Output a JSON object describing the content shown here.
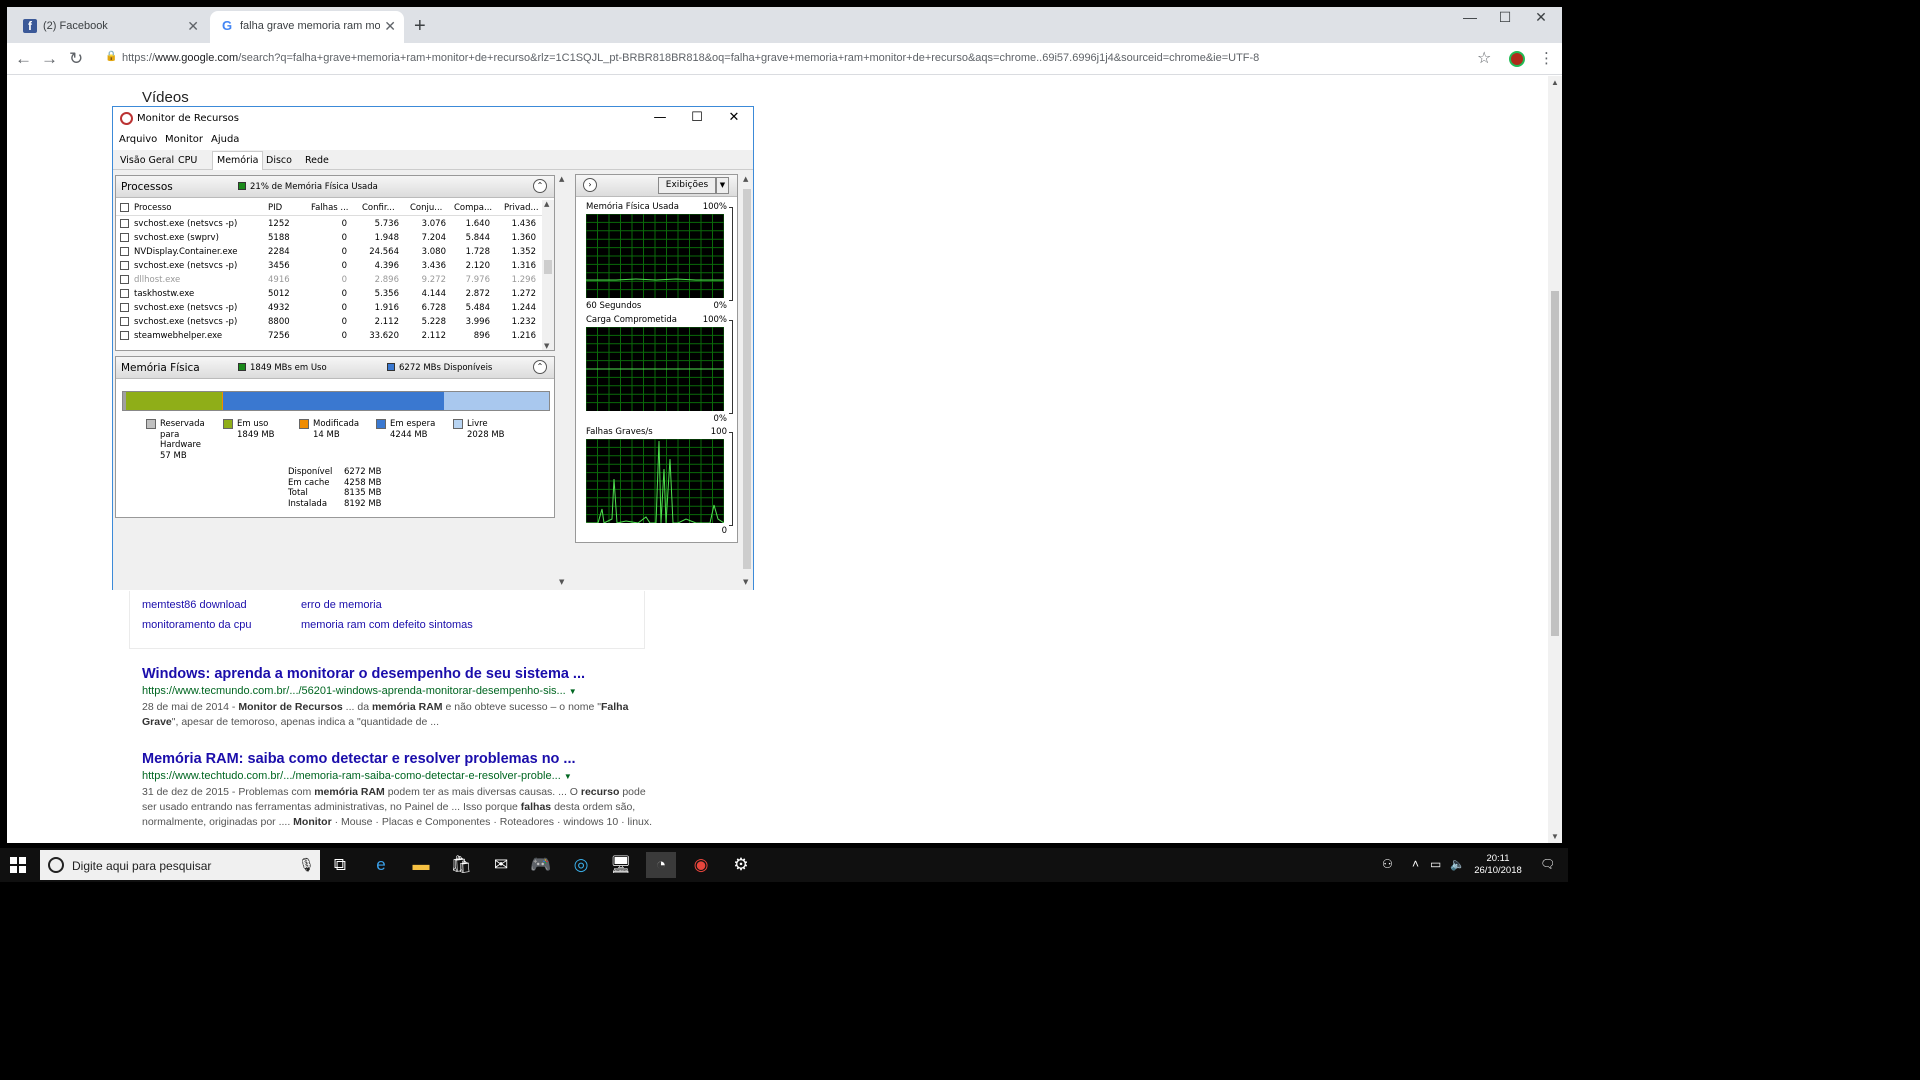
{
  "browser": {
    "tabs": [
      {
        "title": "(2) Facebook",
        "icon": "facebook-icon"
      },
      {
        "title": "falha grave memoria ram monito",
        "icon": "google-icon"
      }
    ],
    "url_prefix": "https://",
    "url_domain": "www.google.com",
    "url_rest": "/search?q=falha+grave+memoria+ram+monitor+de+recurso&rlz=1C1SQJL_pt-BRBR818BR818&oq=falha+grave+memoria+ram+monitor+de+recurso&aqs=chrome..69i57.6996j1j4&sourceid=chrome&ie=UTF-8"
  },
  "search_page": {
    "section_heading": "Vídeos",
    "related": [
      "memtest86 download",
      "erro de memoria",
      "monitoramento da cpu",
      "memoria ram com defeito sintomas"
    ],
    "results": [
      {
        "title": "Windows: aprenda a monitorar o desempenho de seu sistema ...",
        "url": "https://www.tecmundo.com.br/.../56201-windows-aprenda-monitorar-desempenho-sis...",
        "snippet_html": "28 de mai de 2014 - <b>Monitor de Recursos</b> ... da <b>memória RAM</b> e não obteve sucesso – o nome \"<b>Falha Grave</b>\", apesar de temoroso, apenas indica a \"quantidade de ..."
      },
      {
        "title": "Memória RAM: saiba como detectar e resolver problemas no ...",
        "url": "https://www.techtudo.com.br/.../memoria-ram-saiba-como-detectar-e-resolver-proble...",
        "snippet_html": "31 de dez de 2015 - Problemas com <b>memória RAM</b> podem ter as mais diversas causas. ... O <b>recurso</b> pode ser usado entrando nas ferramentas administrativas, no Painel de ... Isso porque <b>falhas</b> desta ordem são, normalmente, originadas por .... <b>Monitor</b> · Mouse · Placas e Componentes · Roteadores · windows 10 · linux."
      }
    ]
  },
  "resmon": {
    "title": "Monitor de Recursos",
    "menu": [
      "Arquivo",
      "Monitor",
      "Ajuda"
    ],
    "tabs": [
      "Visão Geral",
      "CPU",
      "Memória",
      "Disco",
      "Rede"
    ],
    "active_tab": "Memória",
    "processes": {
      "title": "Processos",
      "indicator": "21% de Memória Física Usada",
      "indicator_color": "#1a8a1a",
      "columns": [
        "Processo",
        "PID",
        "Falhas ...",
        "Confir...",
        "Conju...",
        "Compa...",
        "Privad..."
      ],
      "rows": [
        {
          "name": "svchost.exe (netsvcs -p)",
          "pid": "1252",
          "faults": "0",
          "commit": "5.736",
          "ws": "3.076",
          "share": "1.640",
          "priv": "1.436",
          "dim": false
        },
        {
          "name": "svchost.exe (swprv)",
          "pid": "5188",
          "faults": "0",
          "commit": "1.948",
          "ws": "7.204",
          "share": "5.844",
          "priv": "1.360",
          "dim": false
        },
        {
          "name": "NVDisplay.Container.exe",
          "pid": "2284",
          "faults": "0",
          "commit": "24.564",
          "ws": "3.080",
          "share": "1.728",
          "priv": "1.352",
          "dim": false
        },
        {
          "name": "svchost.exe (netsvcs -p)",
          "pid": "3456",
          "faults": "0",
          "commit": "4.396",
          "ws": "3.436",
          "share": "2.120",
          "priv": "1.316",
          "dim": false
        },
        {
          "name": "dllhost.exe",
          "pid": "4916",
          "faults": "0",
          "commit": "2.896",
          "ws": "9.272",
          "share": "7.976",
          "priv": "1.296",
          "dim": true
        },
        {
          "name": "taskhostw.exe",
          "pid": "5012",
          "faults": "0",
          "commit": "5.356",
          "ws": "4.144",
          "share": "2.872",
          "priv": "1.272",
          "dim": false
        },
        {
          "name": "svchost.exe (netsvcs -p)",
          "pid": "4932",
          "faults": "0",
          "commit": "1.916",
          "ws": "6.728",
          "share": "5.484",
          "priv": "1.244",
          "dim": false
        },
        {
          "name": "svchost.exe (netsvcs -p)",
          "pid": "8800",
          "faults": "0",
          "commit": "2.112",
          "ws": "5.228",
          "share": "3.996",
          "priv": "1.232",
          "dim": false
        },
        {
          "name": "steamwebhelper.exe",
          "pid": "7256",
          "faults": "0",
          "commit": "33.620",
          "ws": "2.112",
          "share": "896",
          "priv": "1.216",
          "dim": false
        }
      ]
    },
    "physical": {
      "title": "Memória Física",
      "in_use_indicator": "1849 MBs em Uso",
      "available_indicator": "6272 MBs Disponíveis",
      "bar": [
        {
          "key": "reserved",
          "mb": 57,
          "color": "#a0a0a0"
        },
        {
          "key": "inuse",
          "mb": 1849,
          "color": "#8fae18"
        },
        {
          "key": "modified",
          "mb": 14,
          "color": "#f08c00"
        },
        {
          "key": "standby",
          "mb": 4244,
          "color": "#3a78d0"
        },
        {
          "key": "free",
          "mb": 2028,
          "color": "#a9c8ee"
        }
      ],
      "legend": [
        {
          "label": "Reservada\npara\nHardware\n57 MB",
          "color": "#c0c0c0"
        },
        {
          "label": "Em uso\n1849 MB",
          "color": "#8fae18"
        },
        {
          "label": "Modificada\n14 MB",
          "color": "#f08c00"
        },
        {
          "label": "Em espera\n4244 MB",
          "color": "#3a78d0"
        },
        {
          "label": "Livre\n2028 MB",
          "color": "#b8d4f2"
        }
      ],
      "summary": [
        {
          "label": "Disponível",
          "value": "6272 MB"
        },
        {
          "label": "Em cache",
          "value": "4258 MB"
        },
        {
          "label": "Total",
          "value": "8135 MB"
        },
        {
          "label": "Instalada",
          "value": "8192 MB"
        }
      ]
    },
    "graphs_panel": {
      "views_button": "Exibições",
      "graphs": [
        {
          "title": "Memória Física Usada",
          "top": "100%",
          "bottom_left": "60 Segundos",
          "bottom_right": "0%"
        },
        {
          "title": "Carga Comprometida",
          "top": "100%",
          "bottom_left": "",
          "bottom_right": "0%"
        },
        {
          "title": "Falhas Graves/s",
          "top": "100",
          "bottom_left": "",
          "bottom_right": "0"
        }
      ]
    }
  },
  "taskbar": {
    "search_placeholder": "Digite aqui para pesquisar",
    "time": "20:11",
    "date": "26/10/2018"
  }
}
